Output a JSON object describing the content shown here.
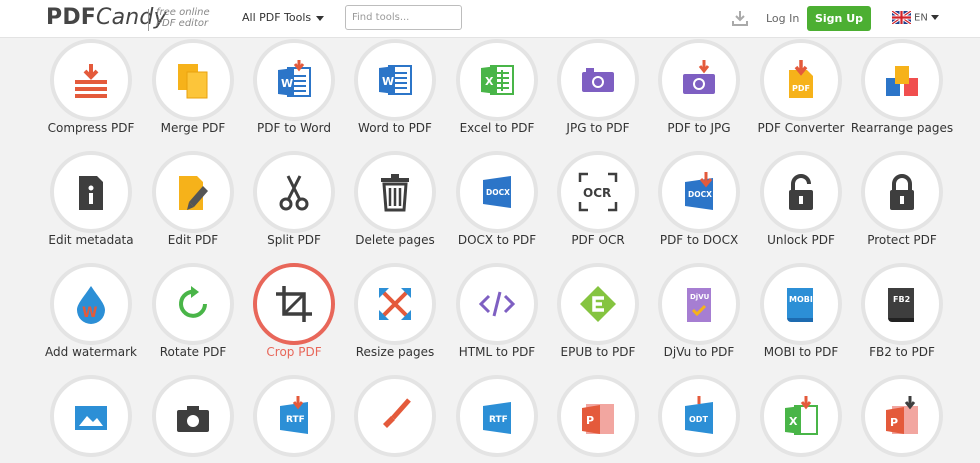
{
  "header": {
    "logo_main": "PDF",
    "logo_candy": "Candy",
    "tagline_line1": "free online",
    "tagline_line2": "PDF editor",
    "tools_menu": "All PDF Tools",
    "search_placeholder": "Find tools...",
    "login": "Log In",
    "signup": "Sign Up",
    "language": "EN",
    "colors": {
      "signup_bg": "#4caf32",
      "active": "#e8675a"
    }
  },
  "tools": [
    {
      "label": "Compress PDF",
      "icon": "compress-icon"
    },
    {
      "label": "Merge PDF",
      "icon": "merge-icon"
    },
    {
      "label": "PDF to Word",
      "icon": "pdf-to-word-icon"
    },
    {
      "label": "Word to PDF",
      "icon": "word-to-pdf-icon"
    },
    {
      "label": "Excel to PDF",
      "icon": "excel-icon"
    },
    {
      "label": "JPG to PDF",
      "icon": "camera-icon"
    },
    {
      "label": "PDF to JPG",
      "icon": "camera-arrow-icon"
    },
    {
      "label": "PDF Converter",
      "icon": "pdf-converter-icon"
    },
    {
      "label": "Rearrange pages",
      "icon": "rearrange-icon"
    },
    {
      "label": "Edit metadata",
      "icon": "metadata-icon"
    },
    {
      "label": "Edit PDF",
      "icon": "edit-icon"
    },
    {
      "label": "Split PDF",
      "icon": "scissors-icon"
    },
    {
      "label": "Delete pages",
      "icon": "trash-icon"
    },
    {
      "label": "DOCX to PDF",
      "icon": "docx-icon"
    },
    {
      "label": "PDF OCR",
      "icon": "ocr-icon"
    },
    {
      "label": "PDF to DOCX",
      "icon": "docx-arrow-icon"
    },
    {
      "label": "Unlock PDF",
      "icon": "unlock-icon"
    },
    {
      "label": "Protect PDF",
      "icon": "lock-icon"
    },
    {
      "label": "Add watermark",
      "icon": "watermark-icon"
    },
    {
      "label": "Rotate PDF",
      "icon": "rotate-icon"
    },
    {
      "label": "Crop PDF",
      "icon": "crop-icon",
      "active": true
    },
    {
      "label": "Resize pages",
      "icon": "resize-icon"
    },
    {
      "label": "HTML to PDF",
      "icon": "html-icon"
    },
    {
      "label": "EPUB to PDF",
      "icon": "epub-icon"
    },
    {
      "label": "DjVu to PDF",
      "icon": "djvu-icon"
    },
    {
      "label": "MOBI to PDF",
      "icon": "mobi-icon"
    },
    {
      "label": "FB2 to PDF",
      "icon": "fb2-icon"
    },
    {
      "label": "",
      "icon": "image-icon"
    },
    {
      "label": "",
      "icon": "photo-camera-icon"
    },
    {
      "label": "",
      "icon": "rtf-arrow-icon"
    },
    {
      "label": "",
      "icon": "brush-icon"
    },
    {
      "label": "",
      "icon": "rtf-icon"
    },
    {
      "label": "",
      "icon": "ppt-icon"
    },
    {
      "label": "",
      "icon": "odt-icon"
    },
    {
      "label": "",
      "icon": "excel-arrow-icon"
    },
    {
      "label": "",
      "icon": "ppt-arrow-icon"
    }
  ]
}
